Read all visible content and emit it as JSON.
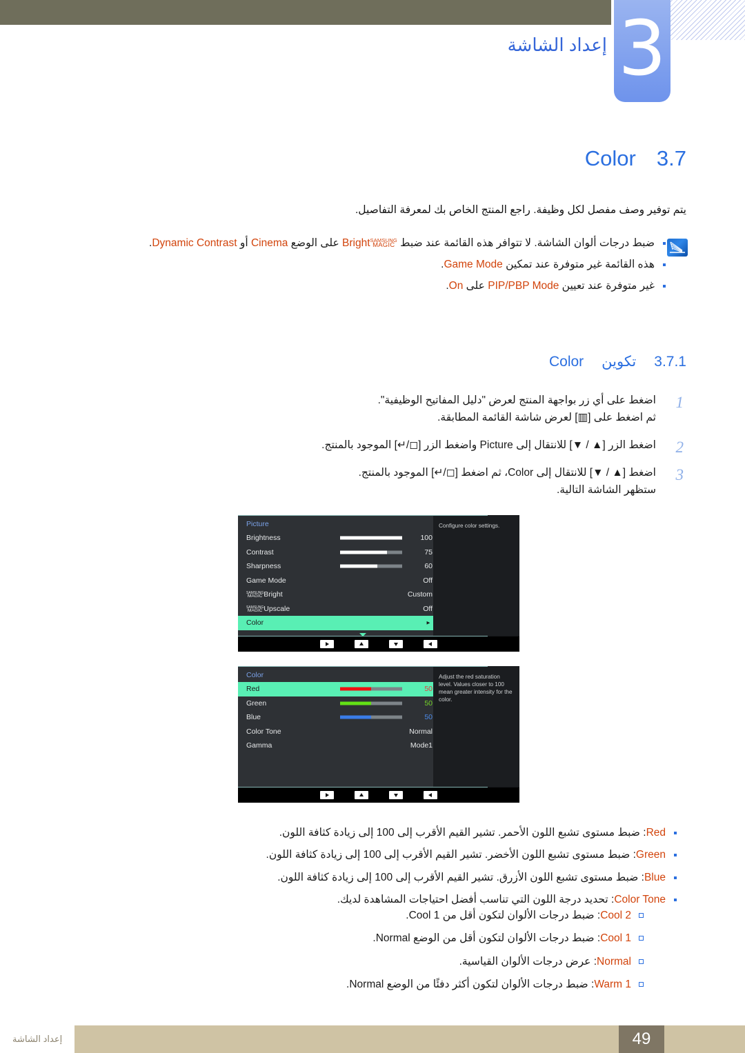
{
  "header": {
    "chapter_number": "3",
    "chapter_title": "إعداد الشاشة",
    "topbar_color": "#6f6e5b",
    "tab_color": "#6e93ec"
  },
  "section": {
    "number": "3.7",
    "name": "Color",
    "intro": "يتم توفير وصف مفصل لكل وظيفة. راجع المنتج الخاص بك لمعرفة التفاصيل."
  },
  "notes": {
    "icon_name": "samsung-note-icon",
    "items": [
      "ضبط درجات ألوان الشاشة. لا تتوافر هذه القائمة عند ضبط SAMSUNGMAGICBright على الوضع Cinema أو Dynamic Contrast.",
      "هذه القائمة غير متوفرة عند تمكين Game Mode.",
      "غير متوفرة عند تعيين PIP/PBP Mode على On."
    ]
  },
  "subsection": {
    "number": "3.7.1",
    "label": "تكوين",
    "name": "Color"
  },
  "steps": [
    {
      "n": "1",
      "line1": "اضغط على أي زر بواجهة المنتج لعرض \"دليل المفاتيح الوظيفية\".",
      "line2": "ثم اضغط على [▥] لعرض شاشة القائمة المطابقة."
    },
    {
      "n": "2",
      "line1": "اضغط الزر [▲ / ▼] للانتقال إلى Picture واضغط الزر [◻/↵] الموجود بالمنتج.",
      "line2": ""
    },
    {
      "n": "3",
      "line1": "اضغط [▲ / ▼] للانتقال إلى Color، ثم اضغط [◻/↵] الموجود بالمنتج.",
      "line2": "ستظهر الشاشة التالية."
    }
  ],
  "osd_picture": {
    "title": "Picture",
    "rail_icons": [
      "monitor-icon",
      "dpad-icon",
      "pip-icon",
      "gear-icon",
      "info-icon"
    ],
    "rows": [
      {
        "label": "Brightness",
        "bar": 100,
        "value": "100",
        "type": "slider",
        "selected": false
      },
      {
        "label": "Contrast",
        "bar": 75,
        "value": "75",
        "type": "slider",
        "selected": false
      },
      {
        "label": "Sharpness",
        "bar": 60,
        "value": "60",
        "type": "slider",
        "selected": false
      },
      {
        "label": "Game Mode",
        "bar": 0,
        "value": "Off",
        "type": "value",
        "selected": false
      },
      {
        "label": "MAGICBright",
        "bar": 0,
        "value": "Custom",
        "type": "magic",
        "selected": false
      },
      {
        "label": "MAGICUpscale",
        "bar": 0,
        "value": "Off",
        "type": "magic",
        "selected": false
      },
      {
        "label": "Color",
        "bar": 0,
        "value": "►",
        "type": "submenu",
        "selected": true
      }
    ],
    "help": "Configure color settings.",
    "foot_buttons": [
      "left-arrow-button",
      "down-arrow-button",
      "up-arrow-button",
      "right-arrow-button"
    ]
  },
  "osd_color": {
    "title": "Color",
    "rail_icons": [
      "monitor-icon",
      "dpad-icon",
      "pip-icon",
      "gear-icon",
      "info-icon"
    ],
    "rows": [
      {
        "label": "Red",
        "bar": 50,
        "value": "50",
        "type": "slider",
        "color": "#ee1111",
        "valcolor": "#e04040",
        "selected": true
      },
      {
        "label": "Green",
        "bar": 50,
        "value": "50",
        "type": "slider",
        "color": "#63e016",
        "valcolor": "#74d427",
        "selected": false
      },
      {
        "label": "Blue",
        "bar": 50,
        "value": "50",
        "type": "slider",
        "color": "#3a7ce8",
        "valcolor": "#4b8ae8",
        "selected": false
      },
      {
        "label": "Color Tone",
        "bar": 0,
        "value": "Normal",
        "type": "value",
        "selected": false
      },
      {
        "label": "Gamma",
        "bar": 0,
        "value": "Mode1",
        "type": "value",
        "selected": false
      }
    ],
    "help": "Adjust the red saturation level. Values closer to 100 mean greater intensity for the color.",
    "foot_buttons": [
      "left-arrow-button",
      "down-arrow-button",
      "up-arrow-button",
      "right-arrow-button"
    ]
  },
  "descriptions": [
    {
      "term": "Red",
      "text": ": ضبط مستوى تشبع اللون الأحمر. تشير القيم الأقرب إلى 100 إلى زيادة كثافة اللون."
    },
    {
      "term": "Green",
      "text": ": ضبط مستوى تشبع اللون الأخضر. تشير القيم الأقرب إلى 100 إلى زيادة كثافة اللون."
    },
    {
      "term": "Blue",
      "text": ": ضبط مستوى تشبع اللون الأزرق. تشير القيم الأقرب إلى 100 إلى زيادة كثافة اللون."
    },
    {
      "term": "Color Tone",
      "text": ": تحديد درجة اللون التي تناسب أفضل احتياجات المشاهدة لديك."
    }
  ],
  "color_tone_options": [
    {
      "term": "Cool 2",
      "text": ": ضبط درجات الألوان لتكون أقل من Cool 1."
    },
    {
      "term": "Cool 1",
      "text": ": ضبط درجات الألوان لتكون أقل من الوضع Normal."
    },
    {
      "term": "Normal",
      "text": ": عرض درجات الألوان القياسية."
    },
    {
      "term": "Warm 1",
      "text": ": ضبط درجات الألوان لتكون أكثر دفئًا من الوضع Normal."
    }
  ],
  "footer": {
    "page": "49",
    "text": "إعداد الشاشة"
  }
}
